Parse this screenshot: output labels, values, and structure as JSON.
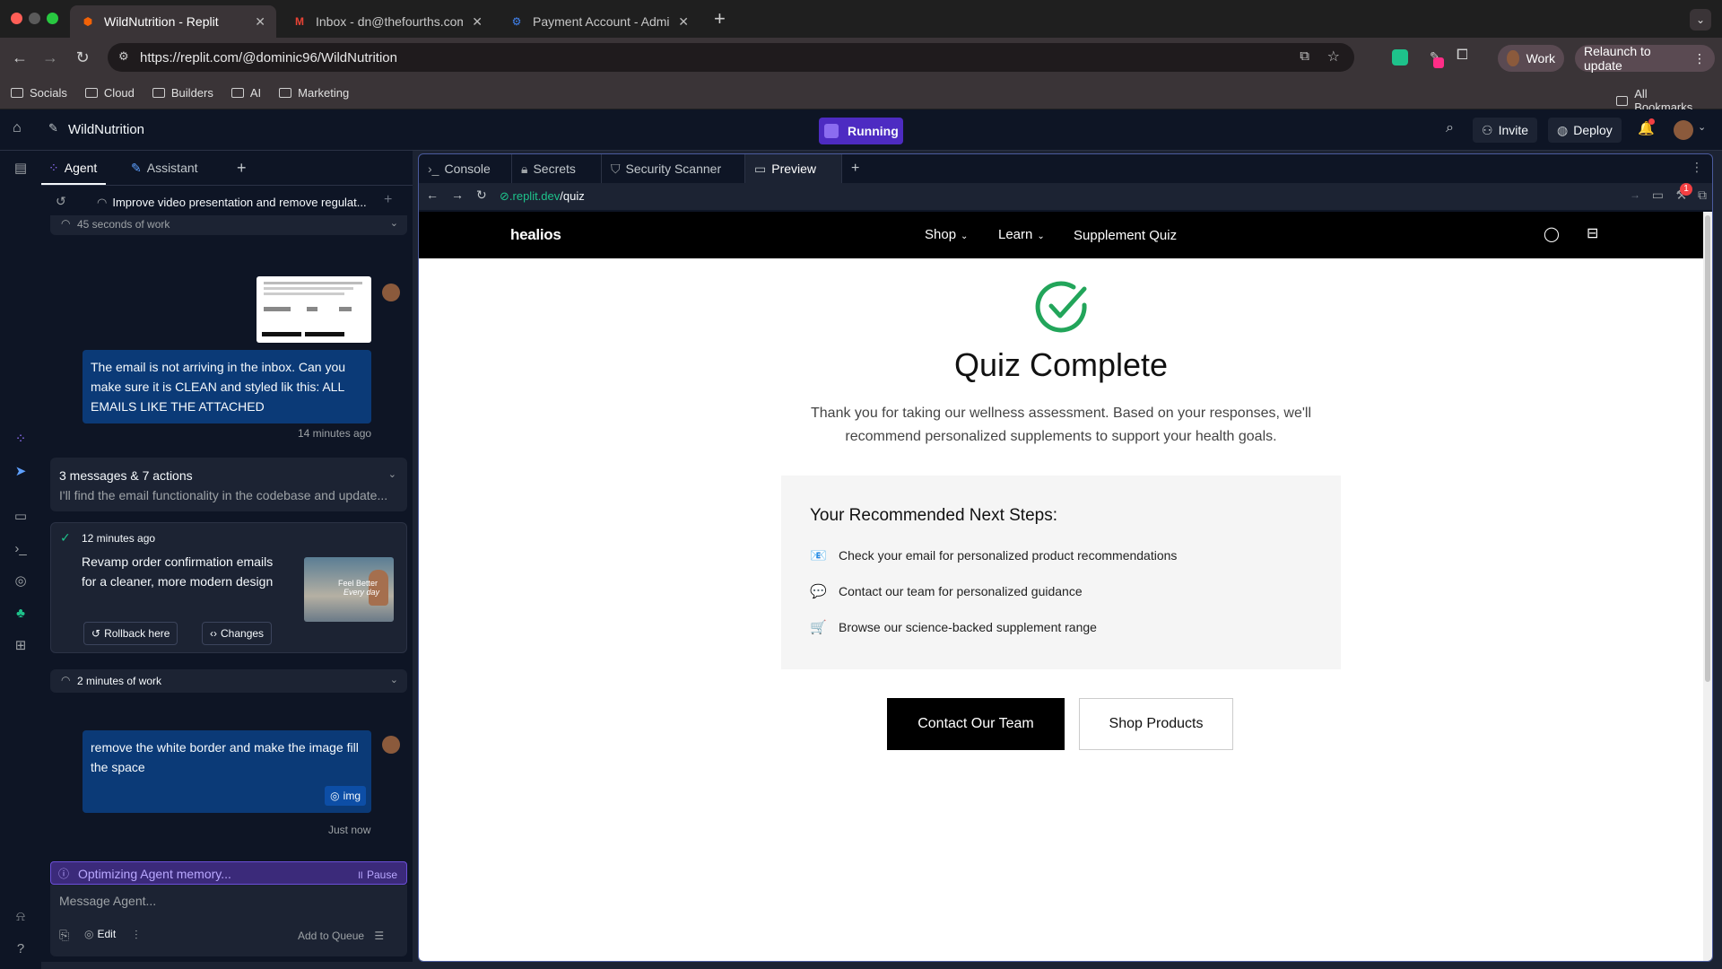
{
  "browser": {
    "tabs": [
      {
        "title": "WildNutrition - Replit",
        "active": true
      },
      {
        "title": "Inbox - dn@thefourths.com -",
        "active": false
      },
      {
        "title": "Payment Account - Admin Co",
        "active": false
      }
    ],
    "url": "https://replit.com/@dominic96/WildNutrition",
    "profile_label": "Work",
    "relaunch_label": "Relaunch to update",
    "bookmarks": [
      "Socials",
      "Cloud",
      "Builders",
      "AI",
      "Marketing"
    ],
    "all_bookmarks": "All Bookmarks"
  },
  "replit": {
    "project_name": "WildNutrition",
    "status": "Running",
    "invite_label": "Invite",
    "deploy_label": "Deploy"
  },
  "agent": {
    "tabs": [
      "Agent",
      "Assistant"
    ],
    "thread_title": "Improve video presentation and remove regulat...",
    "work_summary_1": "45 seconds of work",
    "user_msg_1": "The email is not arriving in the inbox. Can you make sure it is CLEAN and styled lik this: ALL EMAILS LIKE THE ATTACHED",
    "user_msg_1_time": "14 minutes ago",
    "actions_title": "3 messages & 7 actions",
    "actions_preview": "I'll find the email functionality in the codebase and update...",
    "checkpoint_time": "12 minutes ago",
    "checkpoint_desc": "Revamp order confirmation emails for a cleaner, more modern design",
    "rollback_label": "Rollback here",
    "changes_label": "Changes",
    "work_summary_2": "2 minutes of work",
    "user_msg_2": "remove the white border and make the image fill the space",
    "user_msg_2_attachment": "img",
    "user_msg_2_time": "Just now",
    "status_text": "Optimizing Agent memory...",
    "pause_label": "Pause",
    "input_placeholder": "Message Agent...",
    "edit_label": "Edit",
    "queue_label": "Add to Queue",
    "thumb_text_1": "Feel Better",
    "thumb_text_2": "Every day"
  },
  "workspace": {
    "tabs": [
      "Console",
      "Secrets",
      "Security Scanner",
      "Preview"
    ],
    "preview_url_domain": ".replit.dev",
    "preview_url_path": "/quiz",
    "notif_count": "1"
  },
  "site": {
    "logo": "healios",
    "nav": [
      "Shop",
      "Learn",
      "Supplement Quiz"
    ],
    "heading": "Quiz Complete",
    "intro": "Thank you for taking our wellness assessment. Based on your responses, we'll recommend personalized supplements to support your health goals.",
    "steps_title": "Your Recommended Next Steps:",
    "steps": [
      {
        "icon": "📧",
        "text": "Check your email for personalized product recommendations"
      },
      {
        "icon": "💬",
        "text": "Contact our team for personalized guidance"
      },
      {
        "icon": "🛒",
        "text": "Browse our science-backed supplement range"
      }
    ],
    "primary_button": "Contact Our Team",
    "secondary_button": "Shop Products",
    "accent_color": "#22a55a"
  }
}
